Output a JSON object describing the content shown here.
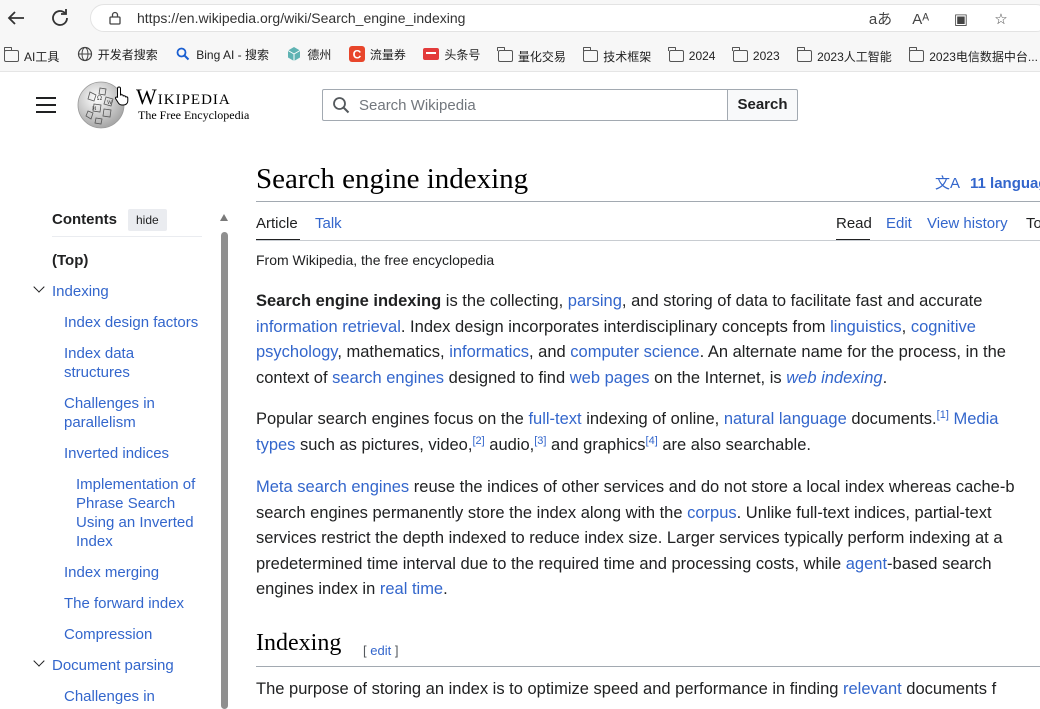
{
  "browser": {
    "url": "https://en.wikipedia.org/wiki/Search_engine_indexing",
    "toolbar_icons": [
      "read-aloud-icon",
      "text-format-icon",
      "split-screen-icon",
      "favorites-icon"
    ],
    "bookmarks": [
      {
        "label": "AI工具",
        "icon": "folder-icon"
      },
      {
        "label": "开发者搜索",
        "icon": "globe-icon"
      },
      {
        "label": "Bing AI - 搜索",
        "icon": "search-icon"
      },
      {
        "label": "德州",
        "icon": "cube-icon"
      },
      {
        "label": "流量券",
        "icon": "c-logo-icon"
      },
      {
        "label": "头条号",
        "icon": "toutiao-icon"
      },
      {
        "label": "量化交易",
        "icon": "folder-icon"
      },
      {
        "label": "技术框架",
        "icon": "folder-icon"
      },
      {
        "label": "2024",
        "icon": "folder-icon"
      },
      {
        "label": "2023",
        "icon": "folder-icon"
      },
      {
        "label": "2023人工智能",
        "icon": "folder-icon"
      },
      {
        "label": "2023电信数据中台...",
        "icon": "folder-icon"
      }
    ]
  },
  "header": {
    "wordmark": "Wikipedia",
    "tagline": "The Free Encyclopedia",
    "search_placeholder": "Search Wikipedia",
    "search_button": "Search"
  },
  "toc": {
    "title": "Contents",
    "hide_label": "hide",
    "items": [
      {
        "label": "(Top)",
        "level": 0
      },
      {
        "label": "Indexing",
        "level": 1,
        "expanded": true
      },
      {
        "label": "Index design factors",
        "level": 2
      },
      {
        "label": "Index data structures",
        "level": 2
      },
      {
        "label": "Challenges in parallelism",
        "level": 2
      },
      {
        "label": "Inverted indices",
        "level": 2
      },
      {
        "label": "Implementation of Phrase Search Using an Inverted Index",
        "level": 3
      },
      {
        "label": "Index merging",
        "level": 2
      },
      {
        "label": "The forward index",
        "level": 2
      },
      {
        "label": "Compression",
        "level": 2
      },
      {
        "label": "Document parsing",
        "level": 1,
        "expanded": true
      },
      {
        "label": "Challenges in",
        "level": 2
      }
    ]
  },
  "article": {
    "title": "Search engine indexing",
    "languages": "11 languag",
    "tabs_left": [
      "Article",
      "Talk"
    ],
    "tabs_right": [
      "Read",
      "Edit",
      "View history",
      "To"
    ],
    "from_line": "From Wikipedia, the free encyclopedia",
    "p1": {
      "bold": "Search engine indexing",
      "t1": " is the collecting, ",
      "l1": "parsing",
      "t2": ", and storing of data to facilitate fast and accurate",
      "l2": "information retrieval",
      "t3": ". Index design incorporates interdisciplinary concepts from ",
      "l3": "linguistics",
      "t4": ", ",
      "l4": "cognitive",
      "l4b": "psychology",
      "t5": ", mathematics, ",
      "l5": "informatics",
      "t6": ", and ",
      "l6": "computer science",
      "t7": ". An alternate name for the process, in the",
      "t8": "context of ",
      "l7": "search engines",
      "t9": " designed to find ",
      "l8": "web pages",
      "t10": " on the Internet, is ",
      "l9": "web indexing",
      "t11": "."
    },
    "p2": {
      "t1": "Popular search engines focus on the ",
      "l1": "full-text",
      "t2": " indexing of online, ",
      "l2": "natural language",
      "t3": " documents.",
      "s1": "[1]",
      "t4": " ",
      "l3": "Media",
      "l3b": "types",
      "t5": " such as pictures, video,",
      "s2": "[2]",
      "t6": " audio,",
      "s3": "[3]",
      "t7": " and graphics",
      "s4": "[4]",
      "t8": " are also searchable."
    },
    "p3": {
      "l1": "Meta search engines",
      "t1": " reuse the indices of other services and do not store a local index whereas cache-b",
      "t2": "search engines permanently store the index along with the ",
      "l2": "corpus",
      "t3": ". Unlike full-text indices, partial-text",
      "t4": "services restrict the depth indexed to reduce index size. Larger services typically perform indexing at a",
      "t5": "predetermined time interval due to the required time and processing costs, while ",
      "l3": "agent",
      "t6": "-based search",
      "t7": "engines index in ",
      "l4": "real time",
      "t8": "."
    },
    "h2": "Indexing",
    "h2_edit": "edit",
    "p4": {
      "t1": "The purpose of storing an index is to optimize speed and performance in finding ",
      "l1": "relevant",
      "t2": " documents f"
    }
  },
  "colors": {
    "link": "#3366cc",
    "text": "#202122",
    "rule": "#a2a9b1"
  }
}
